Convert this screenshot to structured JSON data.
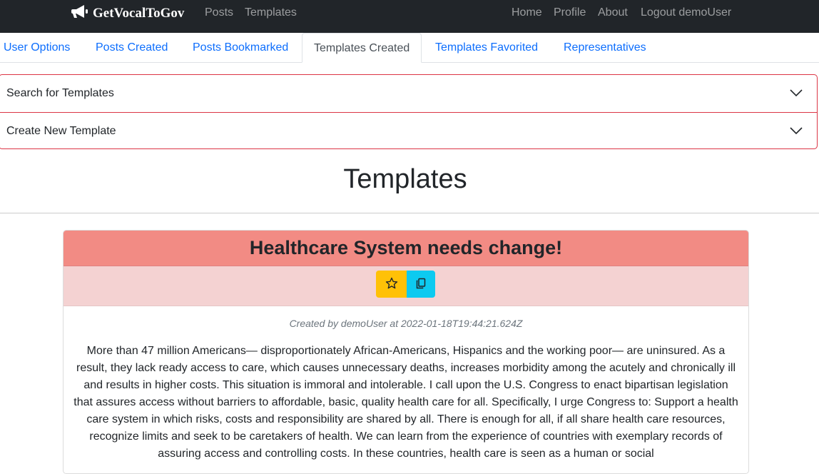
{
  "navbar": {
    "brand": "GetVocalToGov",
    "left_links": [
      "Posts",
      "Templates"
    ],
    "right_links": [
      "Home",
      "Profile",
      "About",
      "Logout demoUser"
    ]
  },
  "tabs": [
    "User Options",
    "Posts Created",
    "Posts Bookmarked",
    "Templates Created",
    "Templates Favorited",
    "Representatives"
  ],
  "active_tab": "Templates Created",
  "accordion": [
    "Search for Templates",
    "Create New Template"
  ],
  "page_heading": "Templates",
  "template": {
    "title": "Healthcare System needs change!",
    "meta": "Created by demoUser at 2022-01-18T19:44:21.624Z",
    "body": "More than 47 million Americans— disproportionately African-Americans, Hispanics and the working poor— are uninsured. As a result, they lack ready access to care, which causes unnecessary deaths, increases morbidity among the acutely and chronically ill and results in higher costs. This situation is immoral and intolerable. I call upon the U.S. Congress to enact bipartisan legislation that assures access without barriers to affordable, basic, quality health care for all. Specifically, I urge Congress to: Support a health care system in which risks, costs and responsibility are shared by all. There is enough for all, if all share health care resources, recognize limits and seek to be caretakers of health. We can learn from the experience of countries with exemplary records of assuring access and controlling costs. In these countries, health care is seen as a human or social"
  },
  "icons": {
    "brand": "megaphone-icon",
    "favorite": "star-icon",
    "copy": "copy-icon",
    "expand": "chevron-down-icon"
  },
  "colors": {
    "navbar": "#212529",
    "link": "#0d6efd",
    "accordion_border": "#dc3545",
    "card_title_bg": "#f28b84",
    "card_actions_bg": "#f4d2d2",
    "favorite_button": "#ffc107",
    "copy_button": "#0dcaf0"
  }
}
